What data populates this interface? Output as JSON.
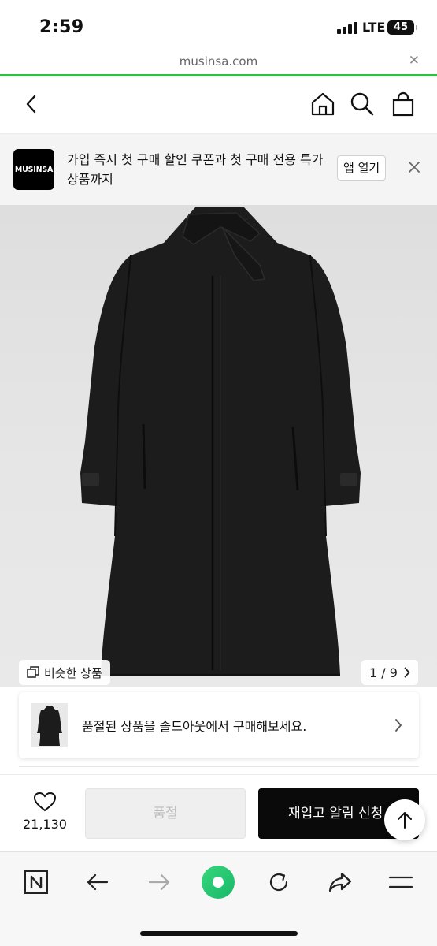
{
  "status_bar": {
    "time": "2:59",
    "network": "LTE",
    "battery": "45"
  },
  "browser": {
    "url": "musinsa.com",
    "close_icon": "close-icon",
    "load_progress_percent": 100
  },
  "header": {
    "icons": [
      "back-chevron-icon",
      "home-icon",
      "search-icon",
      "shopping-bag-icon"
    ]
  },
  "app_banner": {
    "logo_text": "MUSINSA",
    "message": "가입 즉시 첫 구매 할인 쿠폰과 첫 구매 전용 특가 상품까지",
    "open_app_label": "앱 열기"
  },
  "product_image": {
    "similar_label": "비슷한 상품",
    "pager": "1 / 9",
    "colors": {
      "coat": "#1c1c1c",
      "background": "#e2e2e2"
    }
  },
  "soldout_card": {
    "message": "품절된 상품을 솔드아웃에서 구매해보세요."
  },
  "purchase_bar": {
    "like_count": "21,130",
    "soldout_label": "품절",
    "restock_label": "재입고 알림 신청",
    "scroll_top_icon": "arrow-up-icon"
  },
  "browser_toolbar": {
    "icons": [
      "naver-n-icon",
      "back-arrow-icon",
      "forward-arrow-icon",
      "green-circle-icon",
      "refresh-icon",
      "share-icon",
      "menu-icon"
    ]
  },
  "colors": {
    "accent": "#2fbf3e",
    "primary_button": "#0a0a0a",
    "disabled_button": "#efefef"
  }
}
